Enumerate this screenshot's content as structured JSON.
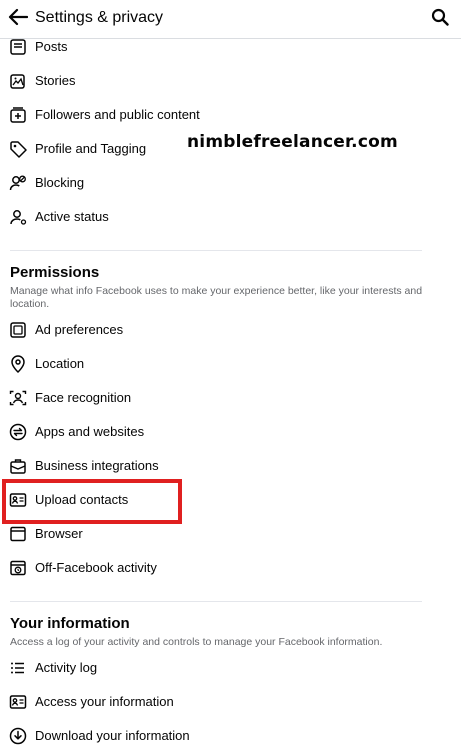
{
  "header": {
    "title": "Settings & privacy",
    "back_icon": "arrow-left-icon",
    "search_icon": "search-icon"
  },
  "watermark": "nimblefreelancer.com",
  "top_items": [
    {
      "label": "Posts",
      "icon": "posts-icon"
    },
    {
      "label": "Stories",
      "icon": "stories-icon"
    },
    {
      "label": "Followers and public content",
      "icon": "followers-icon"
    },
    {
      "label": "Profile and Tagging",
      "icon": "tag-icon"
    },
    {
      "label": "Blocking",
      "icon": "blocking-icon"
    },
    {
      "label": "Active status",
      "icon": "active-status-icon"
    }
  ],
  "permissions": {
    "title": "Permissions",
    "description": "Manage what info Facebook uses to make your experience better, like your interests and location.",
    "items": [
      {
        "label": "Ad preferences",
        "icon": "ad-preferences-icon"
      },
      {
        "label": "Location",
        "icon": "location-pin-icon"
      },
      {
        "label": "Face recognition",
        "icon": "face-recognition-icon"
      },
      {
        "label": "Apps and websites",
        "icon": "apps-websites-icon"
      },
      {
        "label": "Business integrations",
        "icon": "briefcase-icon"
      },
      {
        "label": "Upload contacts",
        "icon": "contact-card-icon"
      },
      {
        "label": "Browser",
        "icon": "browser-icon"
      },
      {
        "label": "Off-Facebook activity",
        "icon": "off-facebook-activity-icon"
      }
    ]
  },
  "your_information": {
    "title": "Your information",
    "description": "Access a log of your activity and controls to manage your Facebook information.",
    "items": [
      {
        "label": "Activity log",
        "icon": "activity-log-icon"
      },
      {
        "label": "Access your information",
        "icon": "access-information-icon"
      },
      {
        "label": "Download your information",
        "icon": "download-icon"
      }
    ]
  },
  "colors": {
    "highlight": "#e02020",
    "text": "#050505",
    "secondary_text": "#65676b",
    "divider": "#e4e6eb"
  }
}
